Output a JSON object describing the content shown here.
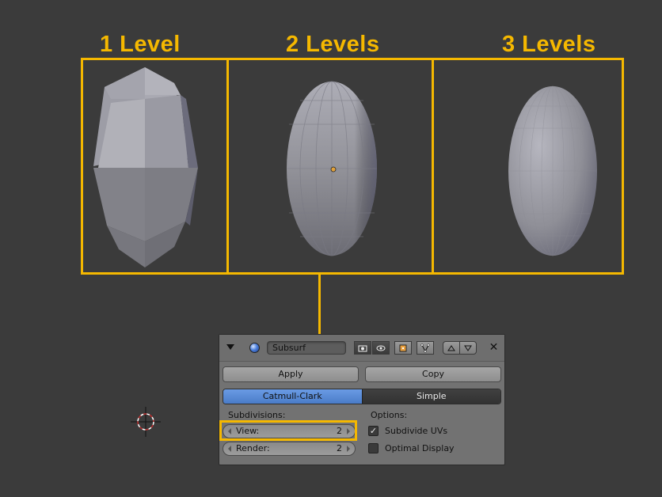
{
  "levels": [
    {
      "title": "1 Level"
    },
    {
      "title": "2 Levels"
    },
    {
      "title": "3 Levels"
    }
  ],
  "colors": {
    "highlight": "#f5b800",
    "background": "#3b3b3b",
    "panel": "#727272",
    "active_tab": "#5a8ad6"
  },
  "modifier": {
    "collapse_icon": "triangle-down-icon",
    "object_icon": "sphere-icon",
    "name": "Subsurf",
    "visibility_icons": [
      "camera-icon",
      "eye-icon",
      "editmode-icon",
      "vertex-icon"
    ],
    "move_icons": [
      "arrow-up-icon",
      "arrow-down-icon"
    ],
    "close_icon": "close-icon",
    "apply_label": "Apply",
    "copy_label": "Copy",
    "algorithms": [
      "Catmull-Clark",
      "Simple"
    ],
    "selected_algorithm": "Catmull-Clark",
    "subdivisions_label": "Subdivisions:",
    "view": {
      "label": "View:",
      "value": "2"
    },
    "render": {
      "label": "Render:",
      "value": "2"
    },
    "options_label": "Options:",
    "subdivide_uvs": {
      "label": "Subdivide UVs",
      "checked": true
    },
    "optimal_display": {
      "label": "Optimal Display",
      "checked": false
    }
  }
}
